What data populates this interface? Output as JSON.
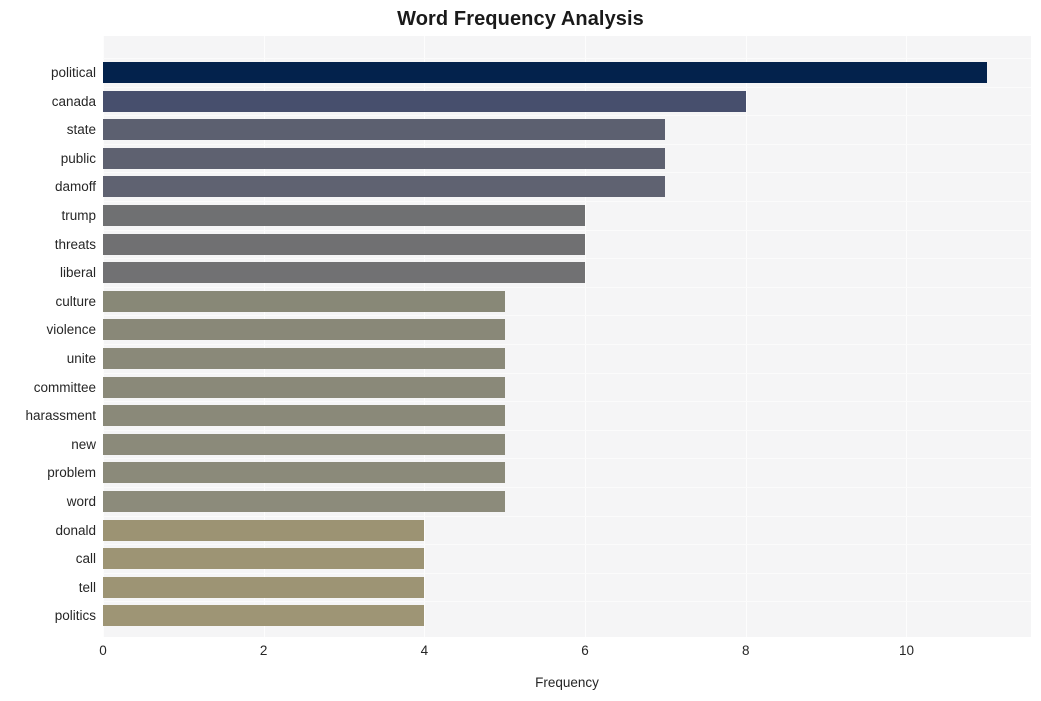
{
  "chart_data": {
    "type": "bar",
    "orientation": "horizontal",
    "title": "Word Frequency Analysis",
    "xlabel": "Frequency",
    "ylabel": "",
    "xlim": [
      0,
      11.55
    ],
    "xticks": [
      0,
      2,
      4,
      6,
      8,
      10
    ],
    "xtick_labels": [
      "0",
      "2",
      "4",
      "6",
      "8",
      "10"
    ],
    "grid": true,
    "legend": "none",
    "categories": [
      "political",
      "canada",
      "state",
      "public",
      "damoff",
      "trump",
      "threats",
      "liberal",
      "culture",
      "violence",
      "unite",
      "committee",
      "harassment",
      "new",
      "problem",
      "word",
      "donald",
      "call",
      "tell",
      "politics"
    ],
    "values": [
      11,
      8,
      7,
      7,
      7,
      6,
      6,
      6,
      5,
      5,
      5,
      5,
      5,
      5,
      5,
      5,
      4,
      4,
      4,
      4
    ],
    "bar_colors": [
      "#03224c",
      "#474f6d",
      "#5c6070",
      "#5e6170",
      "#5f6271",
      "#6f7072",
      "#707072",
      "#717173",
      "#888877",
      "#898878",
      "#8a8979",
      "#8a8979",
      "#8a8979",
      "#8b8a7a",
      "#8b8a7a",
      "#8c8b7b",
      "#9c9373",
      "#9d9474",
      "#9d9474",
      "#9e9575"
    ],
    "plot_background": "#f5f5f6",
    "gridline_color": "#fdfdfd",
    "figure_background": "#ffffff",
    "text_color": "#262626"
  }
}
